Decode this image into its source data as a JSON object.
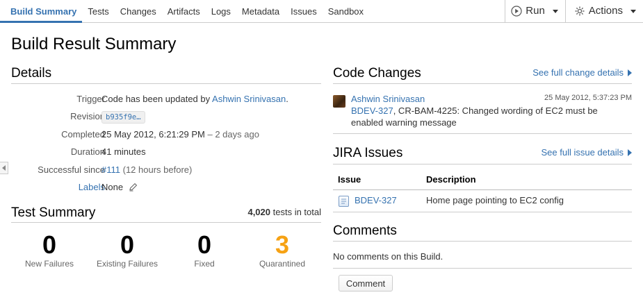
{
  "nav": {
    "tabs": [
      "Build Summary",
      "Tests",
      "Changes",
      "Artifacts",
      "Logs",
      "Metadata",
      "Issues",
      "Sandbox"
    ],
    "run_label": "Run",
    "actions_label": "Actions"
  },
  "page_title": "Build Result Summary",
  "details": {
    "heading": "Details",
    "trigger_label": "Trigger",
    "trigger_prefix": "Code has been updated by ",
    "trigger_user": "Ashwin Srinivasan",
    "trigger_suffix": ".",
    "revision_label": "Revision",
    "revision_value": "b935f9e…",
    "completed_label": "Completed",
    "completed_value": "25 May 2012, 6:21:29 PM",
    "completed_relative": " – 2 days ago",
    "duration_label": "Duration",
    "duration_value": "41 minutes",
    "successful_since_label": "Successful since",
    "successful_since_build": "#111",
    "successful_since_relative": " (12 hours before)",
    "labels_label": "Labels",
    "labels_value": "None"
  },
  "test_summary": {
    "heading": "Test Summary",
    "total_count": "4,020",
    "total_suffix": " tests in total",
    "stats": [
      {
        "value": "0",
        "label": "New Failures"
      },
      {
        "value": "0",
        "label": "Existing Failures"
      },
      {
        "value": "0",
        "label": "Fixed"
      },
      {
        "value": "3",
        "label": "Quarantined"
      }
    ]
  },
  "code_changes": {
    "heading": "Code Changes",
    "see_all": "See full change details",
    "author": "Ashwin Srinivasan",
    "timestamp": "25 May 2012, 5:37:23 PM",
    "issue_key": "BDEV-327",
    "message_line1": ", CR-BAM-4225: Changed wording of EC2 must be",
    "message_line2": "enabled warning message"
  },
  "jira": {
    "heading": "JIRA Issues",
    "see_all": "See full issue details",
    "col_issue": "Issue",
    "col_description": "Description",
    "rows": [
      {
        "key": "BDEV-327",
        "description": "Home page pointing to EC2 config"
      }
    ]
  },
  "comments": {
    "heading": "Comments",
    "empty_text": "No comments on this Build.",
    "button_label": "Comment"
  },
  "colors": {
    "link": "#3572b0",
    "quarantined": "#f6a214"
  }
}
